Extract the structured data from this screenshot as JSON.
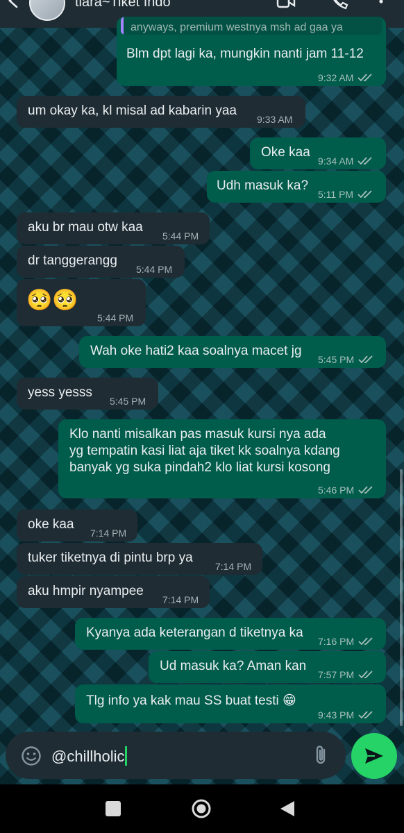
{
  "header": {
    "title": "tiara~Tiket Indo"
  },
  "reply_preview": {
    "text": "anyways, premium westnya msh ad gaa ya"
  },
  "messages": [
    {
      "dir": "out",
      "text": "Blm dpt lagi ka, mungkin nanti jam 11-12",
      "time": "9:32 AM"
    },
    {
      "dir": "in",
      "text": "um okay ka, kl misal ad kabarin yaa",
      "time": "9:33 AM"
    },
    {
      "dir": "out",
      "text": "Oke kaa",
      "time": "9:34 AM"
    },
    {
      "dir": "out",
      "text": "Udh masuk ka?",
      "time": "5:11 PM"
    },
    {
      "dir": "in",
      "text": "aku br mau otw kaa",
      "time": "5:44 PM"
    },
    {
      "dir": "in",
      "text": "dr tanggerangg",
      "time": "5:44 PM"
    },
    {
      "dir": "in",
      "text": "🥺🥺",
      "time": "5:44 PM"
    },
    {
      "dir": "out",
      "text": "Wah oke hati2 kaa soalnya macet jg",
      "time": "5:45 PM"
    },
    {
      "dir": "in",
      "text": "yess yesss",
      "time": "5:45 PM"
    },
    {
      "dir": "out",
      "text": "Klo nanti misalkan pas masuk kursi nya ada\nyg tempatin kasi liat aja tiket kk soalnya kdang\nbanyak yg suka pindah2 klo liat kursi kosong",
      "time": "5:46 PM"
    },
    {
      "dir": "in",
      "text": "oke kaa",
      "time": "7:14 PM"
    },
    {
      "dir": "in",
      "text": "tuker tiketnya di pintu brp ya",
      "time": "7:14 PM"
    },
    {
      "dir": "in",
      "text": "aku hmpir nyampee",
      "time": "7:14 PM"
    },
    {
      "dir": "out",
      "text": "Kyanya ada keterangan d tiketnya ka",
      "time": "7:16 PM"
    },
    {
      "dir": "out",
      "text": "Ud masuk ka? Aman kan",
      "time": "7:57 PM"
    },
    {
      "dir": "out",
      "text": "Tlg info ya kak mau SS buat testi 😁",
      "time": "9:43 PM"
    }
  ],
  "composer": {
    "value": "@chillholic"
  },
  "colors": {
    "incoming_bubble": "#1f2c34",
    "outgoing_bubble": "#005c4b",
    "read_ticks": "#a8c0bb",
    "send_button": "#25d366",
    "reply_bar": "#a684ff"
  },
  "icons": {
    "header": [
      "back-arrow-icon",
      "avatar",
      "video-call-icon",
      "phone-icon",
      "more-options-icon"
    ],
    "composer": [
      "emoji-icon",
      "attach-icon",
      "send-icon"
    ],
    "navigation": [
      "recent-apps-icon",
      "home-icon",
      "back-icon"
    ]
  }
}
